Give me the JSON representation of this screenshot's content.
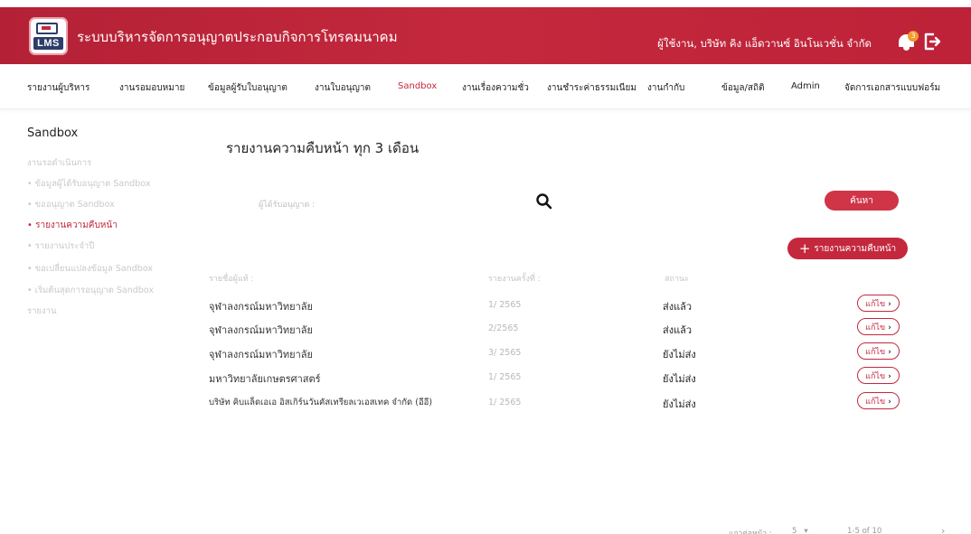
{
  "header": {
    "app_title": "ระบบบริหารจัดการอนุญาตประกอบกิจการโทรคมนาคม",
    "logo_text": "LMS",
    "user_label": "ผู้ใช้งาน, บริษัท คิง แอ็ดวานซ์ อินโนเวชั่น จำกัด",
    "notification_count": "3",
    "brand_color": "#c4283d"
  },
  "nav": {
    "items": [
      "รายงานผู้บริหาร",
      "งานรอมอบหมาย",
      "ข้อมูลผู้รับใบอนุญาต",
      "งานใบอนุญาต",
      "Sandbox",
      "งานเรื่องความชั่ว",
      "งานชำระค่าธรรมเนียม",
      "งานกำกับ",
      "ข้อมูล/สถิติ",
      "Admin",
      "จัดการเอกสารแบบฟอร์ม"
    ],
    "active": "Sandbox"
  },
  "sidebar": {
    "title": "Sandbox",
    "items": [
      "งานรอดำเนินการ",
      "• ข้อมูลผู้ได้รับอนุญาต Sandbox",
      "• ขออนุญาต Sandbox",
      "• รายงานความคืบหน้า",
      "• รายงานประจำปี",
      "• ขอเปลี่ยนแปลงข้อมูล Sandbox",
      "• เริ่มต้นสุดการอนุญาต Sandbox",
      "รายงาน"
    ],
    "active_index": 3
  },
  "main": {
    "title": "รายงานความคืบหน้า ทุก 3 เดือน",
    "filter_label": "ผู้ได้รับอนุญาต :",
    "search_button": "ค้นหา",
    "report_button": "รายงานความคืบหน้า",
    "columns": [
      "รายชื่อผู้แท้ :",
      "รายงานครั้งที่ :",
      "สถานะ"
    ],
    "rows": [
      {
        "name": "จุฬาลงกรณ์มหาวิทยาลัย",
        "round": "1/ 2565",
        "status": "ส่งแล้ว",
        "action": "แก้ไข"
      },
      {
        "name": "จุฬาลงกรณ์มหาวิทยาลัย",
        "round": "2/2565",
        "status": "ส่งแล้ว",
        "action": "แก้ไข"
      },
      {
        "name": "จุฬาลงกรณ์มหาวิทยาลัย",
        "round": "3/ 2565",
        "status": "ยังไม่ส่ง",
        "action": "แก้ไข"
      },
      {
        "name": "มหาวิทยาลัยเกษตรศาสตร์",
        "round": "1/ 2565",
        "status": "ยังไม่ส่ง",
        "action": "แก้ไข"
      },
      {
        "name": "บริษัท คิบแล็ดเอเอ อิสเกิร์นวันคัสเทรียลเวเอสเทค จำกัด (อีอี)",
        "round": "1/ 2565",
        "status": "ยังไม่ส่ง",
        "action": "แก้ไข"
      }
    ]
  },
  "pagination": {
    "rows_per_page_label": "แถวต่อหน้า :",
    "rows_per_page": "5",
    "range": "1-5 of 10"
  }
}
